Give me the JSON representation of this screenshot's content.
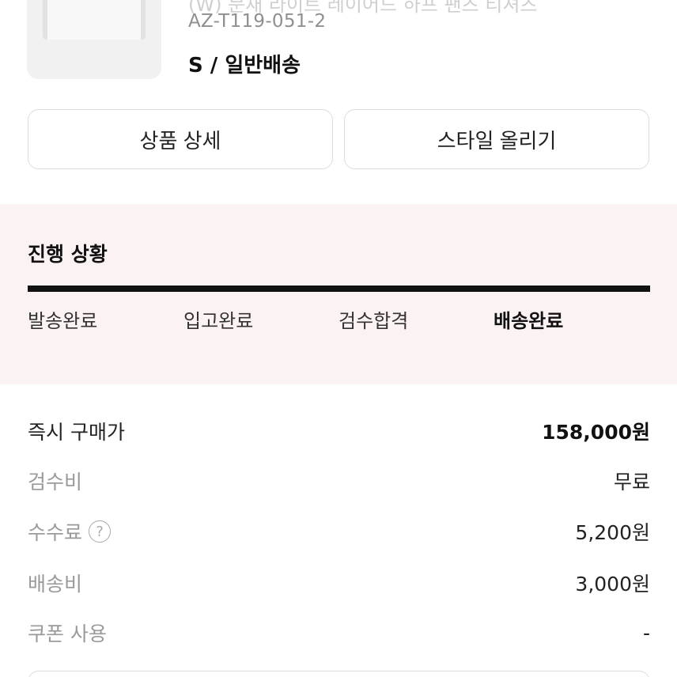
{
  "product": {
    "name": "(W) 문재 라이트 레이어드 하프 팬츠 티셔츠",
    "code": "AZ-T119-051-2",
    "option": "S / 일반배송"
  },
  "actions": {
    "detail_label": "상품 상세",
    "style_label": "스타일 올리기"
  },
  "progress": {
    "title": "진행 상황",
    "fill_fraction": 1.0,
    "steps": [
      {
        "label": "발송완료",
        "active": false
      },
      {
        "label": "입고완료",
        "active": false
      },
      {
        "label": "검수합격",
        "active": false
      },
      {
        "label": "배송완료",
        "active": true
      }
    ]
  },
  "prices": {
    "instant_buy": {
      "label": "즉시 구매가",
      "value": "158,000원"
    },
    "inspection": {
      "label": "검수비",
      "value": "무료"
    },
    "fee": {
      "label": "수수료",
      "value": "5,200원",
      "help_icon": "?"
    },
    "shipping": {
      "label": "배송비",
      "value": "3,000원"
    },
    "coupon": {
      "label": "쿠폰 사용",
      "value": "-"
    }
  },
  "colors": {
    "progress_bg": "#fbf3f3",
    "progress_fill": "#111111"
  }
}
